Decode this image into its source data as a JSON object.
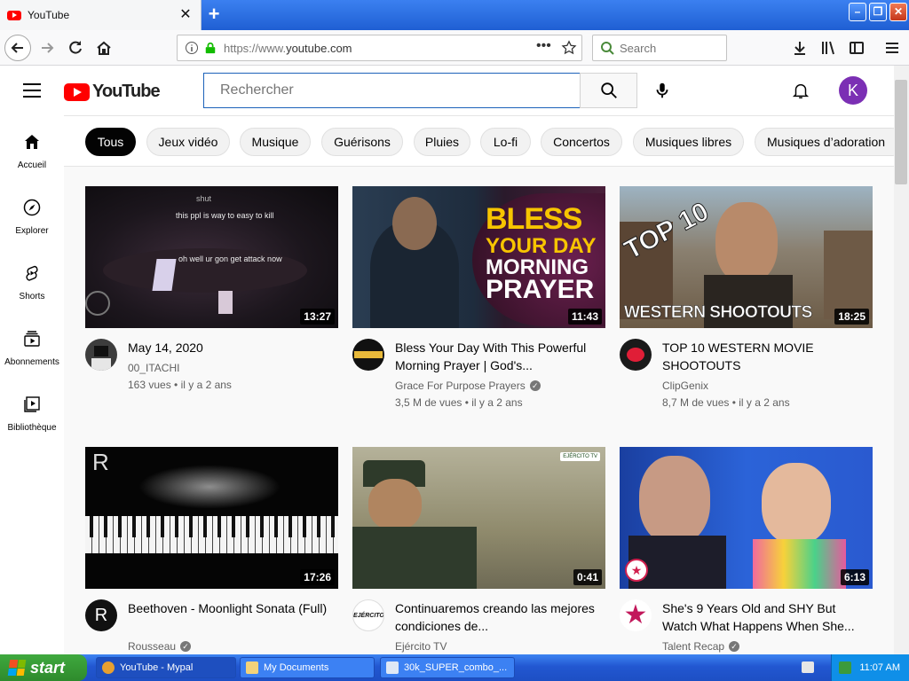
{
  "browser": {
    "tab_title": "YouTube",
    "url_prefix": "https://www.",
    "url_domain": "youtube.com",
    "search_placeholder": "Search"
  },
  "youtube": {
    "search_placeholder": "Rechercher",
    "avatar_letter": "K",
    "logo_text": "YouTube"
  },
  "chips": [
    "Tous",
    "Jeux vidéo",
    "Musique",
    "Guérisons",
    "Pluies",
    "Lo-fi",
    "Concertos",
    "Musiques libres",
    "Musiques d’adoration"
  ],
  "sidebar": [
    {
      "label": "Accueil",
      "icon": "home-icon"
    },
    {
      "label": "Explorer",
      "icon": "compass-icon"
    },
    {
      "label": "Shorts",
      "icon": "shorts-icon"
    },
    {
      "label": "Abonnements",
      "icon": "subscriptions-icon"
    },
    {
      "label": "Bibliothèque",
      "icon": "library-icon"
    }
  ],
  "videos": [
    {
      "title": "May 14, 2020",
      "channel": "00_ITACHI",
      "meta": "163 vues • il y a 2 ans",
      "duration": "13:27",
      "verified": false
    },
    {
      "title": "Bless Your Day With This Powerful Morning Prayer | God's...",
      "channel": "Grace For Purpose Prayers",
      "meta": "3,5 M de vues • il y a 2 ans",
      "duration": "11:43",
      "verified": true
    },
    {
      "title": "TOP 10 WESTERN MOVIE SHOOTOUTS",
      "channel": "ClipGenix",
      "meta": "8,7 M de vues • il y a 2 ans",
      "duration": "18:25",
      "verified": false
    },
    {
      "title": "Beethoven - Moonlight Sonata (Full)",
      "channel": "Rousseau",
      "meta": "",
      "duration": "17:26",
      "verified": true
    },
    {
      "title": "Continuaremos creando las mejores condiciones de...",
      "channel": "Ejército TV",
      "meta": "",
      "duration": "0:41",
      "verified": false
    },
    {
      "title": "She's 9 Years Old and SHY But Watch What Happens When She...",
      "channel": "Talent Recap",
      "meta": "",
      "duration": "6:13",
      "verified": true
    }
  ],
  "thumb_text": {
    "v1_top": "shut",
    "v1_line1": "this ppl is way to easy to kill",
    "v1_line2": "oh well ur gon get attack now",
    "v2_line1": "BLESS",
    "v2_line2": "YOUR DAY",
    "v2_line3": "MORNING",
    "v2_line4": "PRAYER",
    "v3_top": "TOP 10",
    "v3_bottom": "WESTERN SHOOTOUTS",
    "v4_logo": "R",
    "v5_badge": "EJÉRCITO TV"
  },
  "channel_avatar_text": {
    "rousseau": "R",
    "ejercito": "EJÉRCITO TV"
  },
  "taskbar": {
    "start": "start",
    "items": [
      "YouTube - Mypal",
      "My Documents",
      "30k_SUPER_combo_..."
    ],
    "clock": "11:07 AM"
  },
  "colors": {
    "yt_red": "#ff0000",
    "avatar_purple": "#7b2fb4",
    "xp_blue": "#2257d1",
    "start_green": "#3fa93e"
  }
}
